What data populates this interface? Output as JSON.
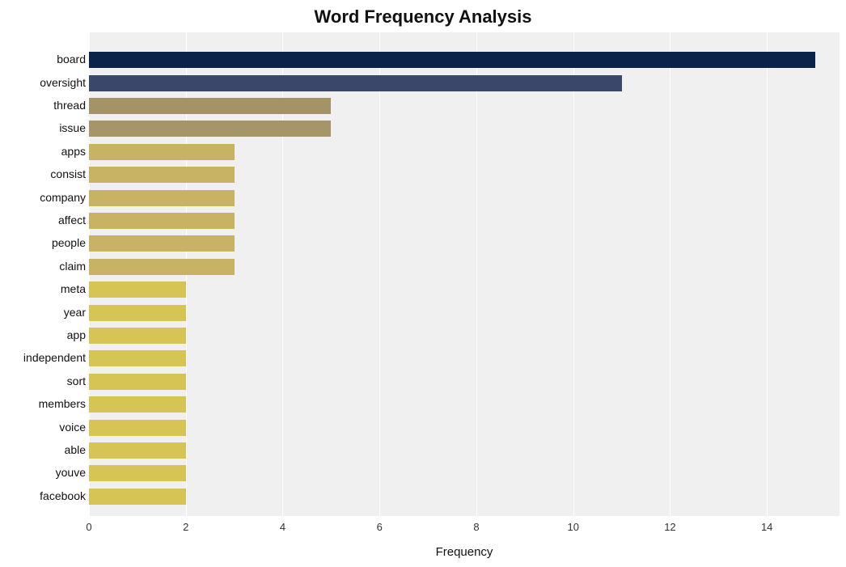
{
  "chart_data": {
    "type": "bar",
    "orientation": "horizontal",
    "title": "Word Frequency Analysis",
    "xlabel": "Frequency",
    "ylabel": "",
    "xlim": [
      0,
      15.5
    ],
    "xticks": [
      0,
      2,
      4,
      6,
      8,
      10,
      12,
      14
    ],
    "categories": [
      "board",
      "oversight",
      "thread",
      "issue",
      "apps",
      "consist",
      "company",
      "affect",
      "people",
      "claim",
      "meta",
      "year",
      "app",
      "independent",
      "sort",
      "members",
      "voice",
      "able",
      "youve",
      "facebook"
    ],
    "values": [
      15,
      11,
      5,
      5,
      3,
      3,
      3,
      3,
      3,
      3,
      2,
      2,
      2,
      2,
      2,
      2,
      2,
      2,
      2,
      2
    ],
    "colors": [
      "#0b2249",
      "#3b466b",
      "#a39367",
      "#a59569",
      "#c8b263",
      "#c8b263",
      "#c8b263",
      "#c8b263",
      "#c8b263",
      "#c8b263",
      "#d6c454",
      "#d6c454",
      "#d6c454",
      "#d6c454",
      "#d6c454",
      "#d6c454",
      "#d6c454",
      "#d6c454",
      "#d6c454",
      "#d6c454"
    ]
  }
}
